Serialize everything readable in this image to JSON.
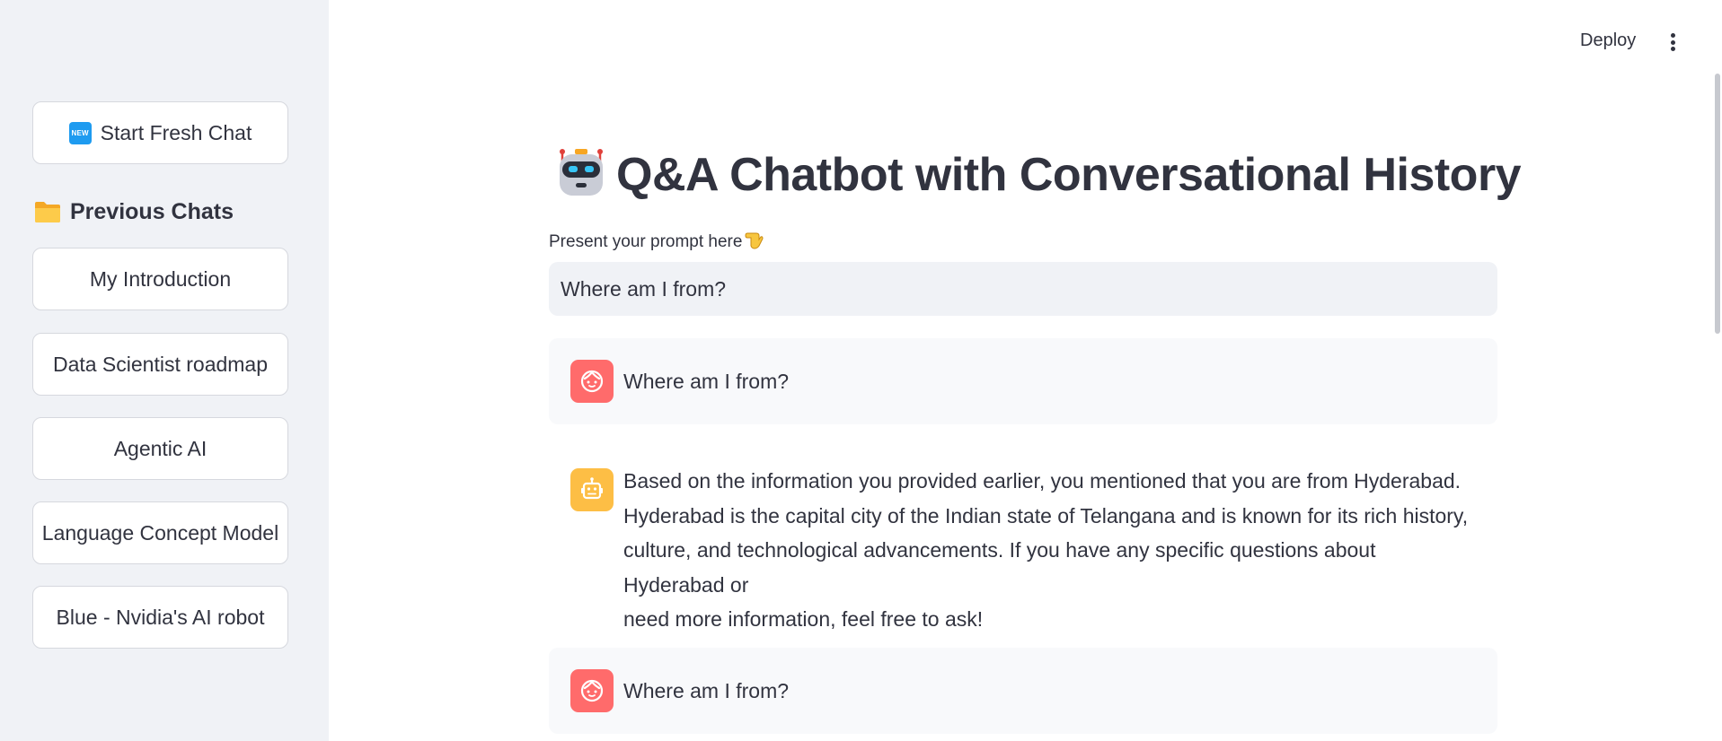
{
  "sidebar": {
    "new_chat_label": "Start Fresh Chat",
    "new_badge": "NEW",
    "previous_heading": "Previous Chats",
    "chats": [
      {
        "label": "My Introduction"
      },
      {
        "label": "Data Scientist roadmap"
      },
      {
        "label": "Agentic AI"
      },
      {
        "label": "Language Concept Model"
      },
      {
        "label": "Blue - Nvidia's AI robot"
      }
    ]
  },
  "topbar": {
    "deploy_label": "Deploy",
    "menu_icon": "kebab-menu-icon"
  },
  "main": {
    "title": "Q&A Chatbot with Conversational History",
    "title_icon": "robot-icon",
    "prompt_label": "Present your prompt here",
    "prompt_label_icon": "pointing-down-emoji",
    "prompt_value": "Where am I from?",
    "messages": [
      {
        "role": "user",
        "avatar_icon": "user-face-icon",
        "text": "Where am I from?"
      },
      {
        "role": "assistant",
        "avatar_icon": "bot-face-icon",
        "lines": [
          "Based on the information you provided earlier, you mentioned that you are from Hyderabad.",
          "Hyderabad is the capital city of the Indian state of Telangana and is known for its rich history,",
          "culture, and technological advancements. If you have any specific questions about Hyderabad or",
          "need more information, feel free to ask!"
        ]
      },
      {
        "role": "user",
        "avatar_icon": "user-face-icon",
        "text": "Where am I from?"
      }
    ]
  },
  "colors": {
    "sidebar_bg": "#f0f2f6",
    "user_avatar": "#ff6b6b",
    "bot_avatar": "#fdbe45",
    "text": "#31333f"
  }
}
